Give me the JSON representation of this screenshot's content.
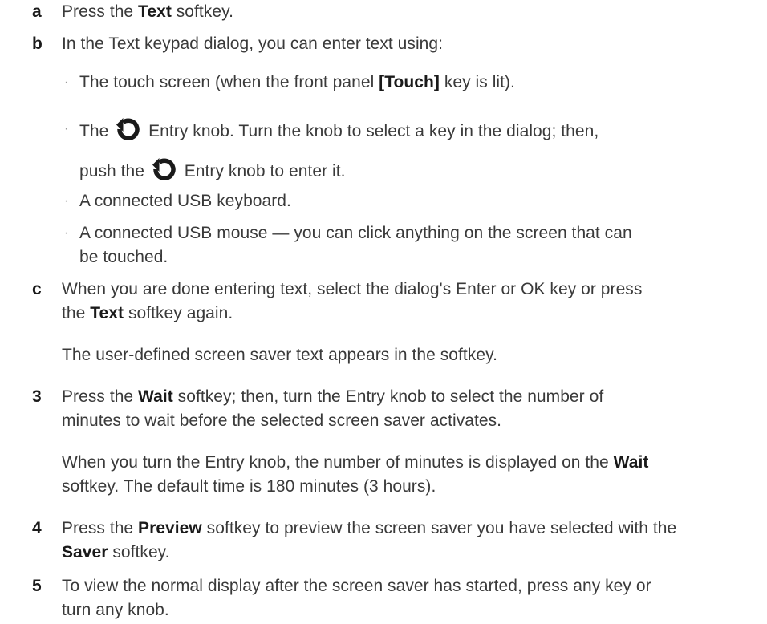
{
  "steps": {
    "a": {
      "label": "a",
      "t1": "Press the ",
      "b1": "Text",
      "t2": " softkey."
    },
    "b": {
      "label": "b",
      "intro": "In the Text keypad dialog, you can enter text using:",
      "bullet1": {
        "t1": "The touch screen (when the front panel ",
        "b1": "[Touch]",
        "t2": " key is lit)."
      },
      "bullet2": {
        "t1": "The ",
        "t2": " Entry knob. Turn the knob to select a key in the dialog; then,",
        "t3": "push the ",
        "t4": " Entry knob to enter it."
      },
      "bullet3": "A connected USB keyboard.",
      "bullet4": {
        "line1": "A connected USB mouse — you can click anything on the screen that can",
        "line2": "be touched."
      }
    },
    "c": {
      "label": "c",
      "line1": "When you are done entering text, select the dialog's Enter or OK key or press",
      "t1": "the ",
      "b1": "Text",
      "t2": " softkey again.",
      "result": "The user-defined screen saver text appears in the softkey."
    },
    "s3": {
      "label": "3",
      "t1": "Press the ",
      "b1": "Wait",
      "t2": " softkey; then, turn the Entry knob to select the number of",
      "line2": "minutes to wait before the selected screen saver activates.",
      "r1": "When you turn the Entry knob, the number of minutes is displayed on the ",
      "rb": "Wait",
      "r2": "softkey. The default time is 180 minutes (3 hours)."
    },
    "s4": {
      "label": "4",
      "t1": "Press the ",
      "b1": "Preview",
      "t2": " softkey to preview the screen saver you have selected with the",
      "b2": "Saver",
      "t3": " softkey."
    },
    "s5": {
      "label": "5",
      "line1": "To view the normal display after the screen saver has started, press any key or",
      "line2": "turn any knob."
    }
  },
  "bullet_glyph": "·",
  "icons": {
    "entry_knob": "entry-knob-icon"
  }
}
